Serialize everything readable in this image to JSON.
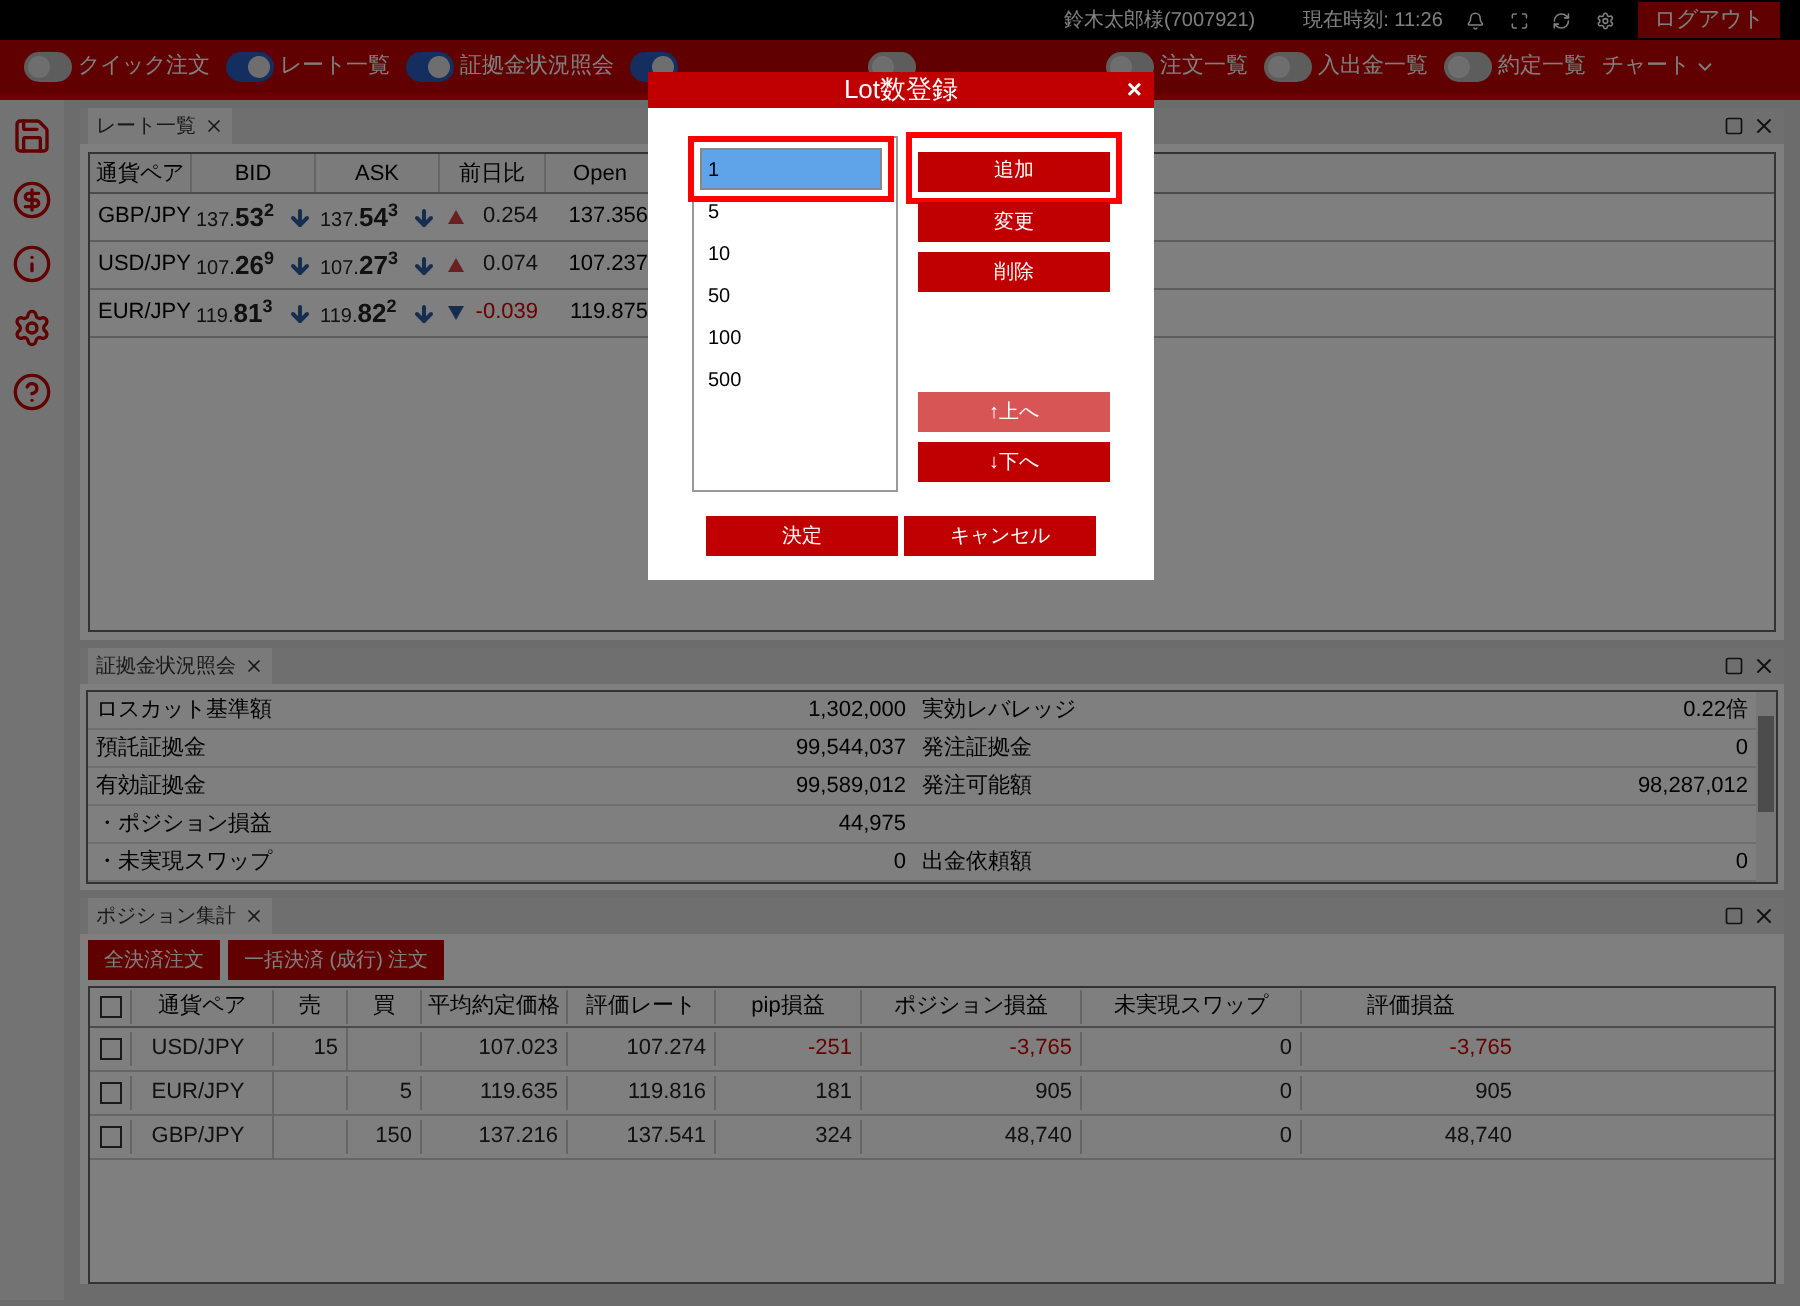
{
  "header": {
    "user": "鈴木太郎様(7007921)",
    "clock": "現在時刻: 11:26",
    "logout": "ログアウト"
  },
  "toolbar": {
    "toggles": [
      {
        "label": "クイック注文",
        "on": false
      },
      {
        "label": "レート一覧",
        "on": true
      },
      {
        "label": "証拠金状況照会",
        "on": true
      },
      {
        "on": true
      },
      {
        "on": false
      },
      {
        "label": "注文一覧",
        "on": false
      },
      {
        "label": "入出金一覧",
        "on": false
      },
      {
        "label": "約定一覧",
        "on": false
      }
    ],
    "chart_menu": "チャート"
  },
  "rate_panel": {
    "title": "レート一覧",
    "columns": [
      "通貨ペア",
      "BID",
      "ASK",
      "前日比",
      "Open"
    ],
    "rows": [
      {
        "pair": "GBP/JPY",
        "bid": {
          "head": "137.",
          "big": "53",
          "pip": "2",
          "falling": true
        },
        "ask": {
          "head": "137.",
          "big": "54",
          "pip": "3",
          "falling": true
        },
        "rising": true,
        "change": "0.254",
        "open": "137.356"
      },
      {
        "pair": "USD/JPY",
        "bid": {
          "head": "107.",
          "big": "26",
          "pip": "9",
          "falling": true
        },
        "ask": {
          "head": "107.",
          "big": "27",
          "pip": "3",
          "falling": true
        },
        "rising": true,
        "change": "0.074",
        "open": "107.237"
      },
      {
        "pair": "EUR/JPY",
        "bid": {
          "head": "119.",
          "big": "81",
          "pip": "3",
          "falling": true
        },
        "ask": {
          "head": "119.",
          "big": "82",
          "pip": "2",
          "falling": true
        },
        "rising": false,
        "change": "-0.039",
        "open": "119.875"
      }
    ]
  },
  "margin_panel": {
    "title": "証拠金状況照会",
    "rows": [
      [
        "ロスカット基準額",
        "1,302,000",
        "実効レバレッジ",
        "0.22倍"
      ],
      [
        "預託証拠金",
        "99,544,037",
        "発注証拠金",
        "0"
      ],
      [
        "有効証拠金",
        "99,589,012",
        "発注可能額",
        "98,287,012"
      ],
      [
        "・ポジション損益",
        "44,975",
        "",
        ""
      ],
      [
        "・未実現スワップ",
        "0",
        "出金依頼額",
        "0"
      ]
    ]
  },
  "position_panel": {
    "title": "ポジション集計",
    "buttons": [
      "全決済注文",
      "一括決済 (成行) 注文"
    ],
    "all_checked": false,
    "columns": [
      "通貨ペア",
      "売",
      "買",
      "平均約定価格",
      "評価レート",
      "pip損益",
      "ポジション損益",
      "未実現スワップ",
      "評価損益"
    ],
    "rows": [
      {
        "checked": false,
        "loss": true,
        "cells": [
          "USD/JPY",
          "15",
          "",
          "107.023",
          "107.274",
          "-251",
          "-3,765",
          "0",
          "-3,765"
        ]
      },
      {
        "checked": false,
        "loss": false,
        "cells": [
          "EUR/JPY",
          "",
          "5",
          "119.635",
          "119.816",
          "181",
          "905",
          "0",
          "905"
        ]
      },
      {
        "checked": false,
        "loss": false,
        "cells": [
          "GBP/JPY",
          "",
          "150",
          "137.216",
          "137.541",
          "324",
          "48,740",
          "0",
          "48,740"
        ]
      }
    ]
  },
  "dialog": {
    "title": "Lot数登録",
    "close": "×",
    "lots": [
      {
        "label": "1",
        "selected": true
      },
      {
        "label": "5",
        "selected": false
      },
      {
        "label": "10",
        "selected": false
      },
      {
        "label": "50",
        "selected": false
      },
      {
        "label": "100",
        "selected": false
      },
      {
        "label": "500",
        "selected": false
      }
    ],
    "actions": [
      {
        "label": "追加",
        "disabled": false,
        "highlighted": true
      },
      {
        "label": "変更",
        "disabled": false,
        "highlighted": false
      },
      {
        "label": "削除",
        "disabled": false,
        "highlighted": false
      }
    ],
    "moves": [
      {
        "label": "↑上へ",
        "disabled": true
      },
      {
        "label": "↓下へ",
        "disabled": false
      }
    ],
    "footer": [
      "決定",
      "キャンセル"
    ]
  }
}
